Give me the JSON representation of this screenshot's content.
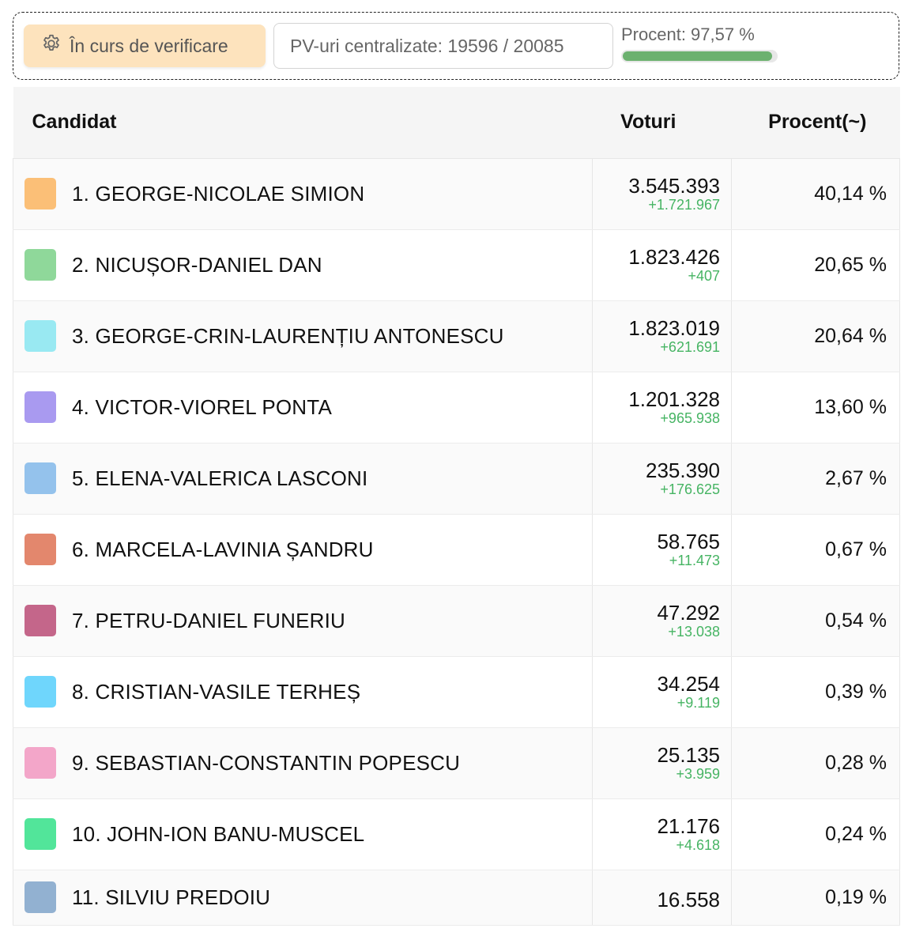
{
  "status": {
    "verify_label": "În curs de verificare",
    "pv_label": "PV-uri centralizate: 19596 / 20085",
    "progress_label": "Procent: 97,57 %",
    "progress_value": 97.57
  },
  "table": {
    "headers": {
      "candidate": "Candidat",
      "votes": "Voturi",
      "percent": "Procent(~)"
    },
    "rows": [
      {
        "name": "1. GEORGE-NICOLAE SIMION",
        "votes": "3.545.393",
        "delta": "+1.721.967",
        "percent": "40,14 %",
        "color": "#fbbf77"
      },
      {
        "name": "2. NICUȘOR-DANIEL DAN",
        "votes": "1.823.426",
        "delta": "+407",
        "percent": "20,65 %",
        "color": "#8fd89a"
      },
      {
        "name": "3. GEORGE-CRIN-LAURENȚIU ANTONESCU",
        "votes": "1.823.019",
        "delta": "+621.691",
        "percent": "20,64 %",
        "color": "#99e9f2"
      },
      {
        "name": "4. VICTOR-VIOREL PONTA",
        "votes": "1.201.328",
        "delta": "+965.938",
        "percent": "13,60 %",
        "color": "#a99af0"
      },
      {
        "name": "5. ELENA-VALERICA LASCONI",
        "votes": "235.390",
        "delta": "+176.625",
        "percent": "2,67 %",
        "color": "#94c2ec"
      },
      {
        "name": "6. MARCELA-LAVINIA ȘANDRU",
        "votes": "58.765",
        "delta": "+11.473",
        "percent": "0,67 %",
        "color": "#e3876d"
      },
      {
        "name": "7. PETRU-DANIEL FUNERIU",
        "votes": "47.292",
        "delta": "+13.038",
        "percent": "0,54 %",
        "color": "#c4668a"
      },
      {
        "name": "8. CRISTIAN-VASILE TERHEȘ",
        "votes": "34.254",
        "delta": "+9.119",
        "percent": "0,39 %",
        "color": "#6fd6fc"
      },
      {
        "name": "9. SEBASTIAN-CONSTANTIN POPESCU",
        "votes": "25.135",
        "delta": "+3.959",
        "percent": "0,28 %",
        "color": "#f3a6c9"
      },
      {
        "name": "10. JOHN-ION BANU-MUSCEL",
        "votes": "21.176",
        "delta": "+4.618",
        "percent": "0,24 %",
        "color": "#52e59a"
      },
      {
        "name": "11. SILVIU PREDOIU",
        "votes": "16.558",
        "delta": "",
        "percent": "0,19 %",
        "color": "#92b1d1"
      }
    ]
  }
}
